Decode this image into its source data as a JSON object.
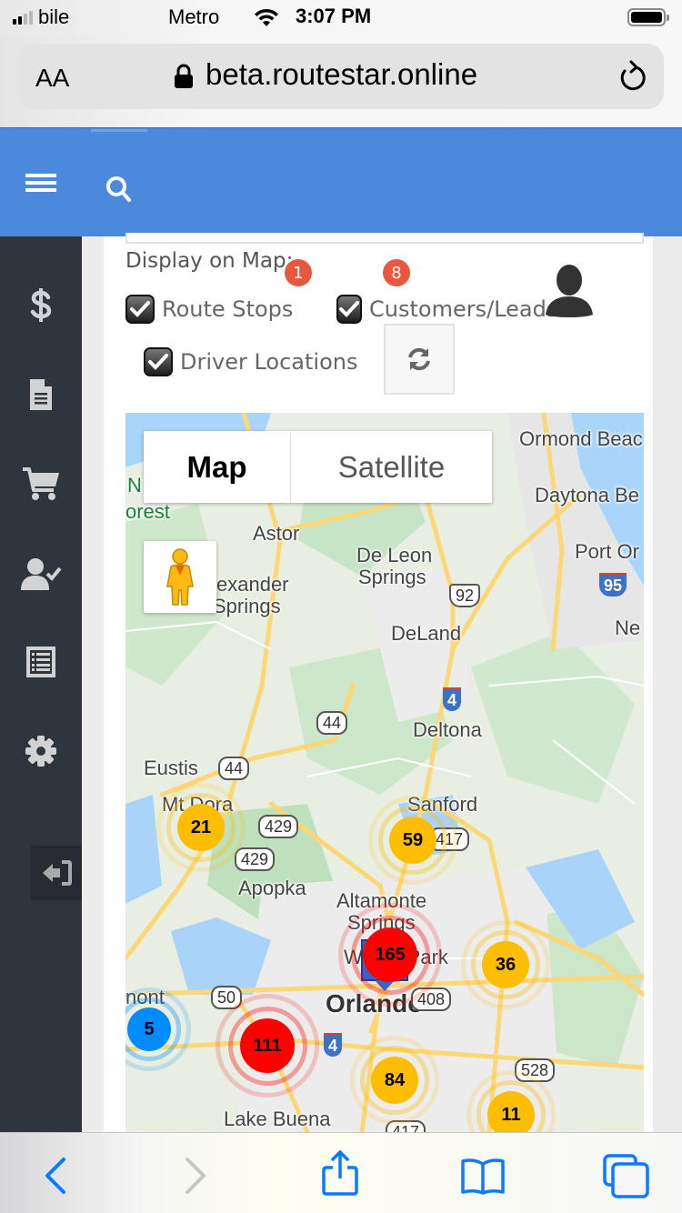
{
  "status_bar": {
    "carrier_left": "bile",
    "carrier_right": "Metro",
    "time": "3:07 PM"
  },
  "browser": {
    "text_size_label": "AA",
    "url": "beta.routestar.online"
  },
  "sidebar": {
    "items": [
      {
        "icon": "dollar-icon"
      },
      {
        "icon": "document-icon"
      },
      {
        "icon": "cart-icon"
      },
      {
        "icon": "user-check-icon"
      },
      {
        "icon": "list-icon"
      },
      {
        "icon": "gear-icon"
      },
      {
        "icon": "logout-icon"
      }
    ]
  },
  "display_options": {
    "label": "Display on Map:",
    "route_stops": {
      "label": "Route Stops",
      "checked": true,
      "badge": "1"
    },
    "customers_leads": {
      "label": "Customers/Leads",
      "checked": true,
      "badge": "8"
    },
    "driver_locations": {
      "label": "Driver Locations",
      "checked": true
    }
  },
  "map": {
    "type_buttons": {
      "map": "Map",
      "satellite": "Satellite"
    },
    "selected_type": "Map",
    "places": {
      "ormond": "Ormond Beac",
      "daytona": "Daytona Be",
      "port_orange": "Port Or",
      "new": "Ne",
      "forest_n": "N",
      "forest": "orest",
      "astor": "Astor",
      "deleon1": "De Leon",
      "deleon2": "Springs",
      "alexander1": "exander",
      "alexander2": "Springs",
      "deland": "DeLand",
      "deltona": "Deltona",
      "eustis": "Eustis",
      "mtdora": "Mt Dora",
      "sanford": "Sanford",
      "apopka": "Apopka",
      "altamonte1": "Altamonte",
      "altamonte2": "Springs",
      "winterpark": "Winter Park",
      "orlando": "Orlando",
      "clermont": "nont",
      "lakebuena": "Lake Buena"
    },
    "road_shields": {
      "us92": "92",
      "i95": "95",
      "i4_north": "4",
      "sr44_a": "44",
      "sr44_b": "44",
      "sr429_a": "429",
      "sr429_b": "429",
      "sr417": "417",
      "sr50": "50",
      "sr408": "408",
      "i4_south": "4",
      "sr528": "528",
      "sr417_b": "417"
    },
    "clusters": [
      {
        "count": "21",
        "color": "#fdbd00"
      },
      {
        "count": "59",
        "color": "#fdbd00"
      },
      {
        "count": "165",
        "color": "#ff0000"
      },
      {
        "count": "36",
        "color": "#fdbd00"
      },
      {
        "count": "5",
        "color": "#008cff"
      },
      {
        "count": "111",
        "color": "#ff0000"
      },
      {
        "count": "84",
        "color": "#fdbd00"
      },
      {
        "count": "11",
        "color": "#fdbd00"
      }
    ]
  },
  "colors": {
    "header_blue": "#4a89dc",
    "sidebar_dark": "#2f353d",
    "badge_red": "#e9573f",
    "ios_blue": "#0a7aff"
  }
}
